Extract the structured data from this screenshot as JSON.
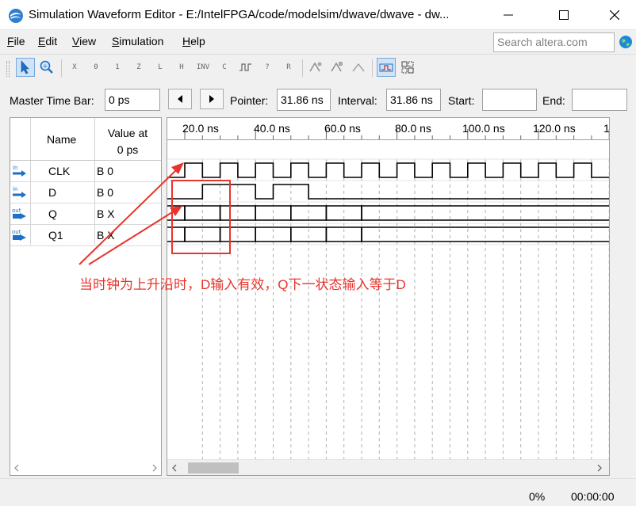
{
  "window": {
    "title": "Simulation Waveform Editor - E:/IntelFPGA/code/modelsim/dwave/dwave - dw..."
  },
  "menu": {
    "items": [
      {
        "label": "File",
        "accel": "F",
        "rest": "ile"
      },
      {
        "label": "Edit",
        "accel": "E",
        "rest": "dit"
      },
      {
        "label": "View",
        "accel": "V",
        "rest": "iew"
      },
      {
        "label": "Simulation",
        "accel": "S",
        "rest": "imulation"
      },
      {
        "label": "Help",
        "accel": "H",
        "rest": "elp"
      }
    ]
  },
  "search": {
    "placeholder": "Search altera.com"
  },
  "toolbar": {
    "buttons": [
      "selection-tool",
      "zoom-tool",
      "uninitialized",
      "forcing-low",
      "forcing-high",
      "high-impedance",
      "weak-low",
      "weak-high",
      "invert",
      "count-value",
      "clock",
      "arbitrary-value",
      "random-value",
      "snap-to-grid",
      "run-functional-simulation",
      "run-timing-simulation",
      "overwrite-clock",
      "grouping"
    ],
    "glyphs": {
      "x": "X",
      "zero": "0",
      "one": "1",
      "z": "Z",
      "l": "L",
      "h": "H",
      "inv": "INV",
      "c": "C",
      "question": "?",
      "r": "R"
    }
  },
  "timebar": {
    "master_label": "Master Time Bar:",
    "master_value": "0 ps",
    "pointer_label": "Pointer:",
    "pointer_value": "31.86 ns",
    "interval_label": "Interval:",
    "interval_value": "31.86 ns",
    "start_label": "Start:",
    "start_value": "",
    "end_label": "End:",
    "end_value": ""
  },
  "signals": {
    "name_header": "Name",
    "value_header_line1": "Value at",
    "value_header_line2": "0 ps",
    "rows": [
      {
        "dir": "in",
        "name": "CLK",
        "value": "B 0"
      },
      {
        "dir": "in",
        "name": "D",
        "value": "B 0"
      },
      {
        "dir": "out",
        "name": "Q",
        "value": "B X"
      },
      {
        "dir": "out",
        "name": "Q1",
        "value": "B X"
      }
    ]
  },
  "ruler": {
    "ticks": [
      "20.0 ns",
      "40.0 ns",
      "60.0 ns",
      "80.0 ns",
      "100.0 ns",
      "120.0 ns",
      "1"
    ]
  },
  "annotation": {
    "text": "当时钟为上升沿时，D输入有效，Q下一状态输入等于D",
    "color": "#e8342c"
  },
  "status": {
    "progress": "0%",
    "elapsed": "00:00:00"
  },
  "colors": {
    "accent": "#1e6fc7",
    "annotation": "#e8342c",
    "wave": "#000000",
    "grid": "#b0b0b0"
  }
}
